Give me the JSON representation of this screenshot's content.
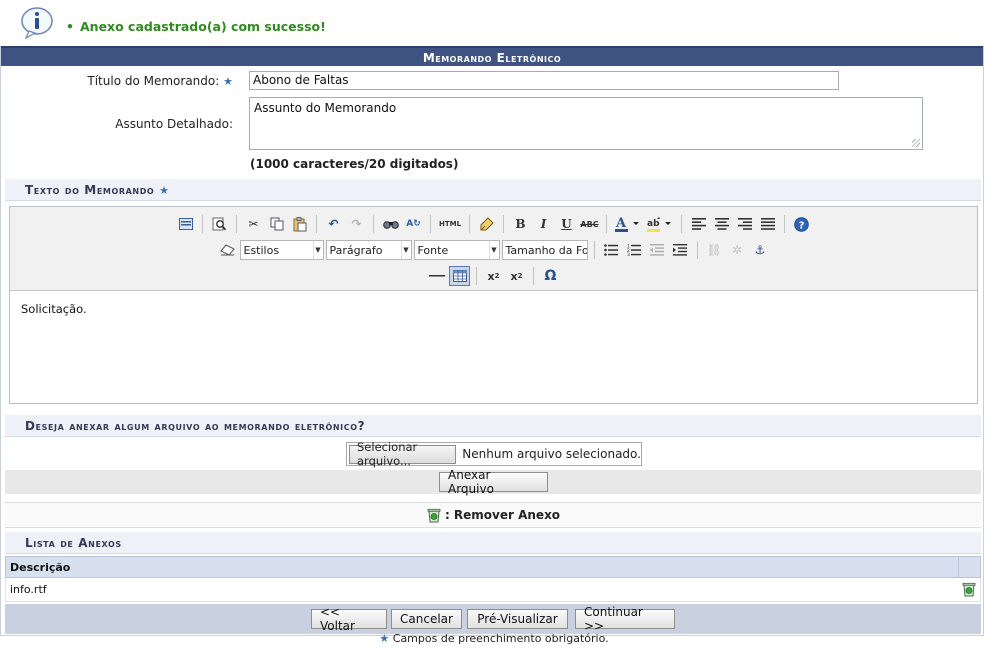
{
  "message": {
    "icon": "info-icon",
    "bullet": "•",
    "text": "Anexo cadastrado(a) com sucesso!"
  },
  "panel": {
    "title": "Memorando Eletrônico"
  },
  "form": {
    "titulo_label": "Título do Memorando:",
    "titulo_value": "Abono de Faltas",
    "assunto_label": "Assunto Detalhado:",
    "assunto_value": "Assunto do Memorando",
    "counter": "(1000 caracteres/20 digitados)"
  },
  "editor": {
    "section_title": "Texto do Memorando",
    "style_select": "Estilos",
    "format_select": "Parágrafo",
    "font_select": "Fonte",
    "size_select": "Tamanho da Fo",
    "content": "Solicitação."
  },
  "attach": {
    "section_title": "Deseja anexar algum arquivo ao memorando eletrônico?",
    "file_button": "Selecionar arquivo...",
    "file_status": "Nenhum arquivo selecionado.",
    "attach_button": "Anexar Arquivo"
  },
  "legend": {
    "remove_label": ": Remover Anexo"
  },
  "attachments": {
    "section_title": "Lista de Anexos",
    "column_desc": "Descrição",
    "rows": [
      {
        "descricao": "info.rtf"
      }
    ]
  },
  "footer": {
    "voltar": "<< Voltar",
    "cancelar": "Cancelar",
    "previsualizar": "Pré-Visualizar",
    "continuar": "Continuar >>",
    "required_note": "Campos de preenchimento obrigatório."
  },
  "colors": {
    "header_blue": "#3f5382",
    "success_green": "#2e8b1e",
    "required_star": "#3b6fb6"
  }
}
